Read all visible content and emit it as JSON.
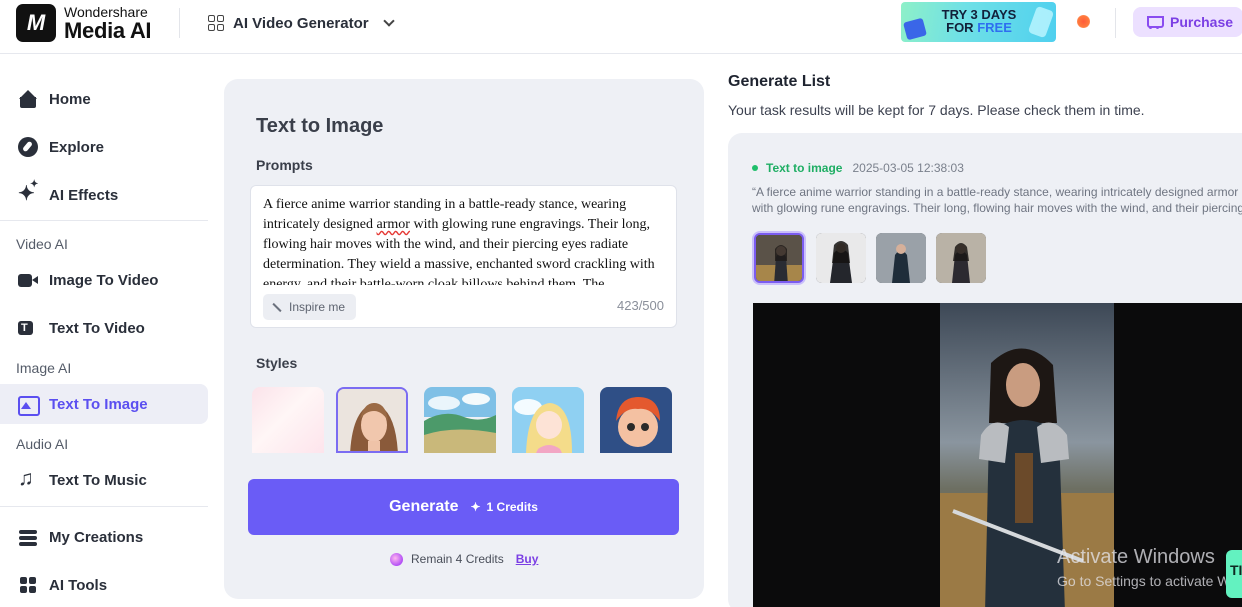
{
  "header": {
    "brand_line1": "Wondershare",
    "brand_line2": "Media AI",
    "logo_glyph": "M",
    "product_switcher": "AI Video Generator",
    "promo_line1": "TRY 3 DAYS",
    "promo_line2a": "FOR ",
    "promo_line2b": "FREE",
    "purchase_label": "Purchase"
  },
  "sidebar": {
    "items": [
      {
        "label": "Home",
        "icon": "home-icon"
      },
      {
        "label": "Explore",
        "icon": "compass-icon"
      },
      {
        "label": "AI Effects",
        "icon": "sparkle-icon"
      }
    ],
    "video_ai": {
      "label": "Video AI",
      "items": [
        {
          "label": "Image To Video",
          "icon": "image-video-icon"
        },
        {
          "label": "Text To Video",
          "icon": "text-video-icon"
        }
      ]
    },
    "image_ai": {
      "label": "Image AI",
      "items": [
        {
          "label": "Text To Image",
          "icon": "text-image-icon",
          "active": true
        }
      ]
    },
    "audio_ai": {
      "label": "Audio AI",
      "items": [
        {
          "label": "Text To Music",
          "icon": "music-icon"
        }
      ]
    },
    "bottom": [
      {
        "label": "My Creations",
        "icon": "layers-icon"
      },
      {
        "label": "AI Tools",
        "icon": "tools-icon"
      }
    ]
  },
  "generator": {
    "title": "Text to Image",
    "prompts_label": "Prompts",
    "prompt_pre": "A fierce anime warrior standing in a battle-ready stance, wearing intricately designed ",
    "prompt_flagged": "armor",
    "prompt_post": " with glowing rune engravings. Their long, flowing hair moves with the wind, and their piercing eyes radiate determination. They wield a massive, enchanted sword crackling with energy, and their battle-worn cloak billows behind them. The",
    "inspire_label": "Inspire me",
    "char_count": "423/500",
    "styles_label": "Styles",
    "styles": [
      {
        "name": "none",
        "selected": false
      },
      {
        "name": "realistic-portrait",
        "selected": true
      },
      {
        "name": "landscape",
        "selected": false
      },
      {
        "name": "anime",
        "selected": false
      },
      {
        "name": "3d-cartoon",
        "selected": false
      }
    ],
    "generate_label": "Generate",
    "generate_cost": "1 Credits",
    "remain_text": "Remain 4 Credits",
    "buy_label": "Buy"
  },
  "generate_list": {
    "title": "Generate List",
    "subtitle": "Your task results will be kept for 7 days. Please check them in time.",
    "task": {
      "type": "Text to image",
      "timestamp": "2025-03-05 12:38:03",
      "prompt_line1": "“A fierce anime warrior standing in a battle-ready stance, wearing intricately designed armor",
      "prompt_line2": "with glowing rune engravings. Their long, flowing hair moves with the wind, and their piercing",
      "thumbnail_count": 4,
      "selected_index": 0
    }
  },
  "os_watermark": {
    "line1": "Activate Windows",
    "line2": "Go to Settings to activate Windows."
  },
  "edge_badge": "TI"
}
